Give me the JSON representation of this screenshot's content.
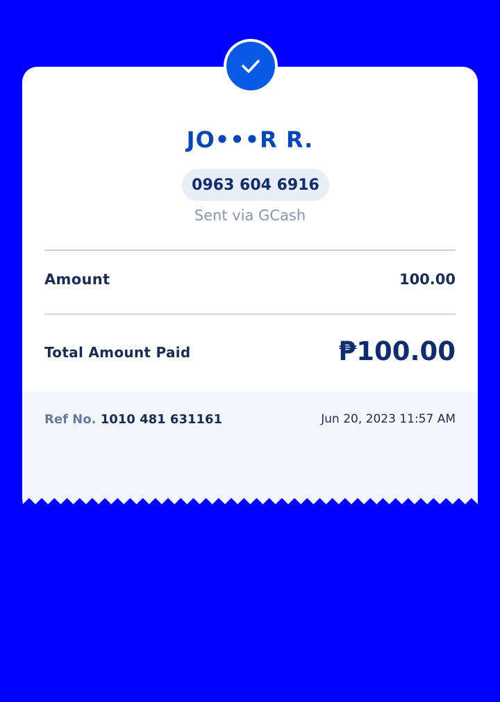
{
  "receipt": {
    "recipient_name": "JO•••R R.",
    "phone_number": "0963 604 6916",
    "sent_via": "Sent via GCash",
    "amount_label": "Amount",
    "amount_value": "100.00",
    "total_label": "Total Amount Paid",
    "total_value": "₱100.00",
    "ref_label": "Ref No.",
    "ref_number": "1010 481 631161",
    "timestamp": "Jun 20, 2023 11:57 AM"
  },
  "icons": {
    "status": "check-icon"
  },
  "colors": {
    "background": "#0000FF",
    "card": "#FFFFFF",
    "card_footer": "#F3F6FB",
    "accent": "#0A5AE6",
    "name": "#0846B8",
    "text_dark": "#1B2C50",
    "text_muted": "#8A96AD"
  }
}
